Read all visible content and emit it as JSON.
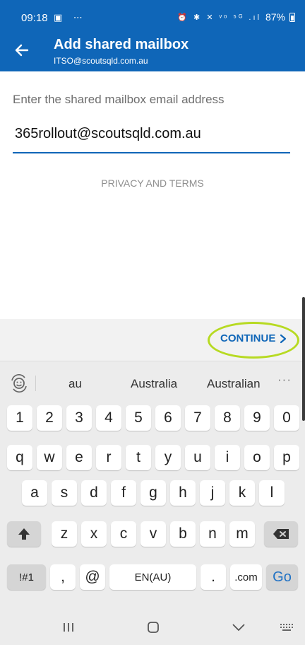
{
  "status_bar": {
    "time": "09:18",
    "left_icons": "▣ ⋯",
    "right_glyphs": "⏰ ✱ ✕ ᵛᵒ ⁵ᴳ .ıl",
    "battery": "87%"
  },
  "app_bar": {
    "title": "Add shared mailbox",
    "subtitle": "ITSO@scoutsqld.com.au",
    "back_icon": "arrow-left-icon"
  },
  "form": {
    "label": "Enter the shared mailbox email address",
    "email_value": "365rollout@scoutsqld.com.au",
    "privacy_link": "PRIVACY AND TERMS"
  },
  "action": {
    "continue_label": "CONTINUE",
    "highlight_color": "#b7da22",
    "accent_color": "#0f66b8"
  },
  "keyboard": {
    "suggestions": [
      "au",
      "Australia",
      "Australian"
    ],
    "more": "···",
    "row_numbers": [
      "1",
      "2",
      "3",
      "4",
      "5",
      "6",
      "7",
      "8",
      "9",
      "0"
    ],
    "row_qwerty": [
      "q",
      "w",
      "e",
      "r",
      "t",
      "y",
      "u",
      "i",
      "o",
      "p"
    ],
    "row_asdf": [
      "a",
      "s",
      "d",
      "f",
      "g",
      "h",
      "j",
      "k",
      "l"
    ],
    "row_zxcv": [
      "z",
      "x",
      "c",
      "v",
      "b",
      "n",
      "m"
    ],
    "symbols_key": "!#1",
    "comma_key": ",",
    "at_key": "@",
    "space_label": "EN(AU)",
    "period_key": ".",
    "dotcom_key": ".com",
    "go_key": "Go"
  },
  "nav": {
    "recents": "|||",
    "home": "◯",
    "back": "﹀"
  }
}
